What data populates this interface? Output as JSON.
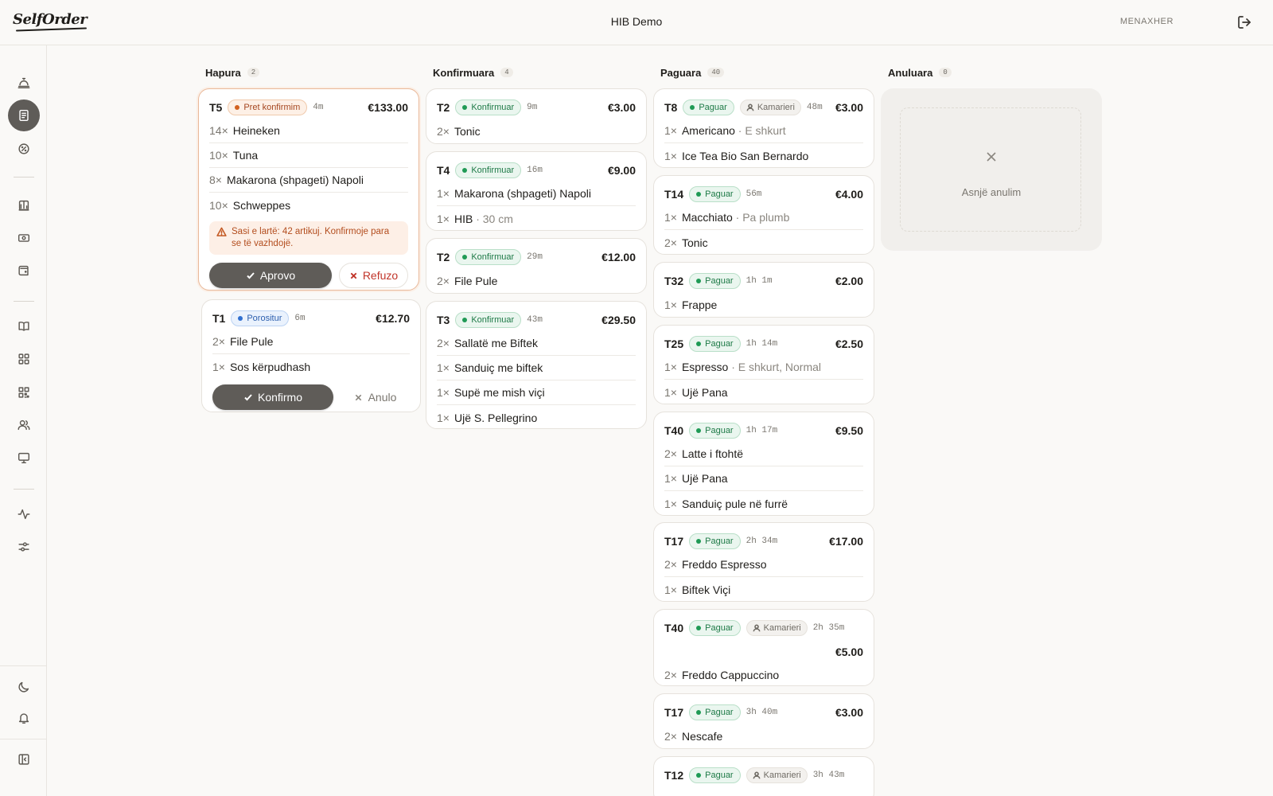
{
  "header": {
    "logo": "SelfOrder",
    "title": "HIB Demo",
    "role": "MENAXHER"
  },
  "columns": [
    {
      "title": "Hapura",
      "count": "2",
      "cards": [
        {
          "table": "T5",
          "status": "Pret konfirmim",
          "age": "4m",
          "total": "€133.00",
          "lines": [
            {
              "qty": "14×",
              "item": "Heineken",
              "mod": ""
            },
            {
              "qty": "10×",
              "item": "Tuna",
              "mod": ""
            },
            {
              "qty": "8×",
              "item": "Makarona (shpageti) Napoli",
              "mod": ""
            },
            {
              "qty": "10×",
              "item": "Schweppes",
              "mod": ""
            }
          ],
          "warning": "Sasi e lartë: 42 artikuj. Konfirmoje para se të vazhdojë.",
          "approve_label": "Aprovo",
          "reject_label": "Refuzo"
        },
        {
          "table": "T1",
          "status": "Porositur",
          "age": "6m",
          "total": "€12.70",
          "lines": [
            {
              "qty": "2×",
              "item": "File Pule",
              "mod": ""
            },
            {
              "qty": "1×",
              "item": "Sos kërpudhash",
              "mod": ""
            }
          ],
          "confirm_label": "Konfirmo",
          "cancel_label": "Anulo"
        }
      ]
    },
    {
      "title": "Konfirmuara",
      "count": "4",
      "cards": [
        {
          "table": "T2",
          "status": "Konfirmuar",
          "age": "9m",
          "total": "€3.00",
          "lines": [
            {
              "qty": "2×",
              "item": "Tonic",
              "mod": ""
            }
          ]
        },
        {
          "table": "T4",
          "status": "Konfirmuar",
          "age": "16m",
          "total": "€9.00",
          "lines": [
            {
              "qty": "1×",
              "item": "Makarona (shpageti) Napoli",
              "mod": ""
            },
            {
              "qty": "1×",
              "item": "HIB",
              "mod": " · 30 cm"
            }
          ]
        },
        {
          "table": "T2",
          "status": "Konfirmuar",
          "age": "29m",
          "total": "€12.00",
          "lines": [
            {
              "qty": "2×",
              "item": "File Pule",
              "mod": ""
            }
          ]
        },
        {
          "table": "T3",
          "status": "Konfirmuar",
          "age": "43m",
          "total": "€29.50",
          "lines": [
            {
              "qty": "2×",
              "item": "Sallatë me Biftek",
              "mod": ""
            },
            {
              "qty": "1×",
              "item": "Sanduiç me biftek",
              "mod": ""
            },
            {
              "qty": "1×",
              "item": "Supë me mish viçi",
              "mod": ""
            },
            {
              "qty": "1×",
              "item": "Ujë S. Pellegrino",
              "mod": ""
            }
          ]
        }
      ]
    },
    {
      "title": "Paguara",
      "count": "40",
      "cards": [
        {
          "table": "T8",
          "status": "Paguar",
          "waiter": "Kamarieri",
          "age": "48m",
          "total": "€3.00",
          "lines": [
            {
              "qty": "1×",
              "item": "Americano",
              "mod": " · E shkurt"
            },
            {
              "qty": "1×",
              "item": "Ice Tea Bio San Bernardo",
              "mod": ""
            }
          ]
        },
        {
          "table": "T14",
          "status": "Paguar",
          "age": "56m",
          "total": "€4.00",
          "lines": [
            {
              "qty": "1×",
              "item": "Macchiato",
              "mod": " · Pa plumb"
            },
            {
              "qty": "2×",
              "item": "Tonic",
              "mod": ""
            }
          ]
        },
        {
          "table": "T32",
          "status": "Paguar",
          "age": "1h 1m",
          "total": "€2.00",
          "lines": [
            {
              "qty": "1×",
              "item": "Frappe",
              "mod": ""
            }
          ]
        },
        {
          "table": "T25",
          "status": "Paguar",
          "age": "1h 14m",
          "total": "€2.50",
          "lines": [
            {
              "qty": "1×",
              "item": "Espresso",
              "mod": " · E shkurt, Normal"
            },
            {
              "qty": "1×",
              "item": "Ujë Pana",
              "mod": ""
            }
          ]
        },
        {
          "table": "T40",
          "status": "Paguar",
          "age": "1h 17m",
          "total": "€9.50",
          "lines": [
            {
              "qty": "2×",
              "item": "Latte i ftohtë",
              "mod": ""
            },
            {
              "qty": "1×",
              "item": "Ujë Pana",
              "mod": ""
            },
            {
              "qty": "1×",
              "item": "Sanduiç pule në furrë",
              "mod": ""
            }
          ]
        },
        {
          "table": "T17",
          "status": "Paguar",
          "age": "2h 34m",
          "total": "€17.00",
          "lines": [
            {
              "qty": "2×",
              "item": "Freddo Espresso",
              "mod": ""
            },
            {
              "qty": "1×",
              "item": "Biftek Viçi",
              "mod": ""
            }
          ]
        },
        {
          "table": "T40",
          "status": "Paguar",
          "waiter": "Kamarieri",
          "age": "2h 35m",
          "total": "€5.00",
          "lines": [
            {
              "qty": "2×",
              "item": "Freddo Cappuccino",
              "mod": ""
            }
          ]
        },
        {
          "table": "T17",
          "status": "Paguar",
          "age": "3h 40m",
          "total": "€3.00",
          "lines": [
            {
              "qty": "2×",
              "item": "Nescafe",
              "mod": ""
            }
          ]
        },
        {
          "table": "T12",
          "status": "Paguar",
          "waiter": "Kamarieri",
          "age": "3h 43m",
          "total": "",
          "lines": []
        }
      ]
    },
    {
      "title": "Anuluara",
      "count": "0",
      "empty_text": "Asnjë anulim"
    }
  ]
}
